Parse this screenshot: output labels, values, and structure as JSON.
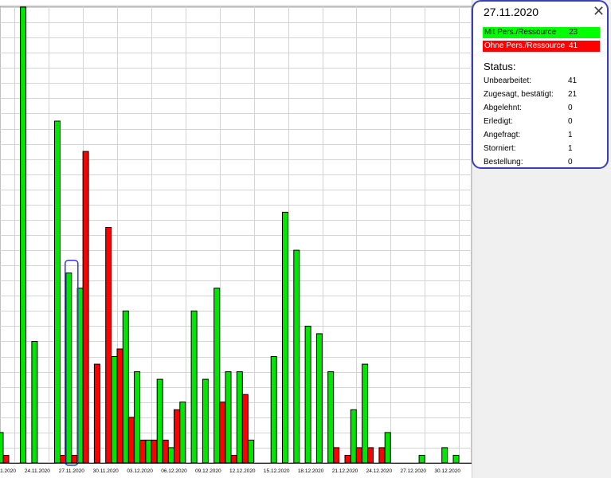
{
  "chart_data": {
    "type": "bar",
    "categories": [
      "21.11.2020",
      "22.11.2020",
      "23.11.2020",
      "24.11.2020",
      "25.11.2020",
      "26.11.2020",
      "27.11.2020",
      "28.11.2020",
      "29.11.2020",
      "30.11.2020",
      "01.12.2020",
      "02.12.2020",
      "03.12.2020",
      "04.12.2020",
      "05.12.2020",
      "06.12.2020",
      "07.12.2020",
      "08.12.2020",
      "09.12.2020",
      "10.12.2020",
      "11.12.2020",
      "12.12.2020",
      "13.12.2020",
      "14.12.2020",
      "15.12.2020",
      "16.12.2020",
      "17.12.2020",
      "18.12.2020",
      "19.12.2020",
      "20.12.2020",
      "21.12.2020",
      "22.12.2020",
      "23.12.2020",
      "24.12.2020",
      "25.12.2020",
      "26.12.2020",
      "27.12.2020",
      "28.12.2020",
      "29.12.2020",
      "30.12.2020",
      "31.12.2020"
    ],
    "tick_labels": [
      "21.11.2020",
      "24.11.2020",
      "27.11.2020",
      "30.11.2020",
      "03.12.2020",
      "06.12.2020",
      "09.12.2020",
      "12.12.2020",
      "15.12.2020",
      "18.12.2020",
      "21.12.2020",
      "24.12.2020",
      "27.12.2020",
      "30.12.2020"
    ],
    "series": [
      {
        "name": "Mit Pers./Ressource",
        "color": "#00e600",
        "values": [
          4,
          0,
          60,
          16,
          0,
          45,
          25,
          23,
          0,
          0,
          14,
          20,
          12,
          3,
          11,
          2,
          8,
          20,
          11,
          23,
          12,
          12,
          3,
          0,
          14,
          33,
          28,
          18,
          17,
          12,
          0,
          7,
          13,
          0,
          4,
          0,
          0,
          1,
          0,
          2,
          1
        ]
      },
      {
        "name": "Ohne Pers./Ressource",
        "color": "#ff0000",
        "values": [
          1,
          0,
          0,
          0,
          0,
          1,
          1,
          41,
          13,
          31,
          15,
          6,
          3,
          3,
          3,
          7,
          0,
          0,
          0,
          8,
          1,
          9,
          0,
          0,
          0,
          0,
          0,
          0,
          0,
          2,
          1,
          2,
          2,
          2,
          0,
          0,
          0,
          0,
          0,
          0,
          0
        ]
      }
    ],
    "ylim": [
      0,
      60
    ],
    "grid": true,
    "highlighted_category": "27.11.2020"
  },
  "tooltip": {
    "date": "27.11.2020",
    "close_glyph": "✕",
    "legend": [
      {
        "label": "Mit Pers./Ressource",
        "value": "23",
        "color": "#00ff00"
      },
      {
        "label": "Ohne Pers./Ressource",
        "value": "41",
        "color": "#ff0000"
      }
    ],
    "status_heading": "Status:",
    "status_rows": [
      {
        "label": "Unbearbeitet:",
        "value": "41"
      },
      {
        "label": "Zugesagt, bestätigt:",
        "value": "21"
      },
      {
        "label": "Abgelehnt:",
        "value": "0"
      },
      {
        "label": "Erledigt:",
        "value": "0"
      },
      {
        "label": "Angefragt:",
        "value": "1"
      },
      {
        "label": "Storniert:",
        "value": "1"
      },
      {
        "label": "Bestellung:",
        "value": "0"
      }
    ]
  }
}
